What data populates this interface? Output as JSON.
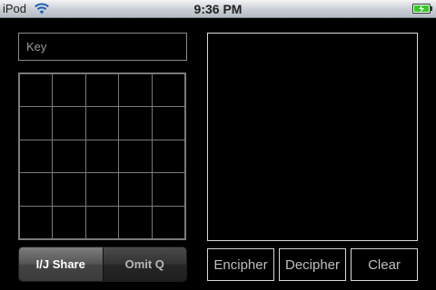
{
  "status_bar": {
    "carrier": "iPod",
    "time": "9:36 PM",
    "wifi_icon": "wifi-icon",
    "battery_icon": "battery-charging-icon",
    "battery_color": "#34c924"
  },
  "key": {
    "placeholder": "Key",
    "value": ""
  },
  "grid": {
    "rows": [
      [
        "",
        "",
        "",
        "",
        ""
      ],
      [
        "",
        "",
        "",
        "",
        ""
      ],
      [
        "",
        "",
        "",
        "",
        ""
      ],
      [
        "",
        "",
        "",
        "",
        ""
      ],
      [
        "",
        "",
        "",
        "",
        ""
      ]
    ]
  },
  "mode_control": {
    "options": [
      "I/J Share",
      "Omit Q"
    ],
    "selected": "I/J Share"
  },
  "output": {
    "text": ""
  },
  "buttons": {
    "encipher": "Encipher",
    "decipher": "Decipher",
    "clear": "Clear"
  }
}
